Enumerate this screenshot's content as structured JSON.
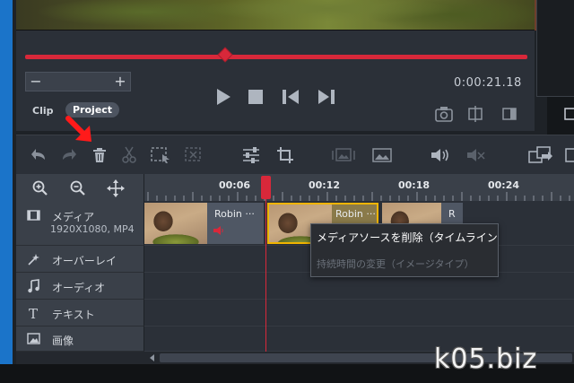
{
  "player": {
    "zoom_minus": "−",
    "zoom_plus": "+",
    "timecode": "0:00:21.18",
    "tabs": [
      {
        "label": "Clip"
      },
      {
        "label": "Project"
      }
    ]
  },
  "toolbar": {
    "icons": [
      "undo-icon",
      "redo-icon",
      "trash-icon",
      "cut-icon",
      "crop-select-icon",
      "split-icon",
      "settings-sliders-icon",
      "crop-icon",
      "image-prev-icon",
      "image-icon",
      "volume-icon",
      "mute-icon",
      "insert-icon"
    ]
  },
  "ruler": {
    "labels": [
      "00:06",
      "00:12",
      "00:18",
      "00:24"
    ]
  },
  "tracks": [
    {
      "label": "メディア",
      "meta": "1920X1080, MP4"
    },
    {
      "label": "オーバーレイ"
    },
    {
      "label": "オーディオ"
    },
    {
      "label": "テキスト"
    },
    {
      "label": "画像"
    }
  ],
  "clips": [
    {
      "name": "Robin ···"
    },
    {
      "name": "Robin ···"
    },
    {
      "name": "R"
    }
  ],
  "tooltip": {
    "line1": "メディアソースを削除（タイムライン",
    "line2": "持続時間の変更（イメージタイプ）"
  },
  "watermark": "k05.biz",
  "colors": {
    "accent_red": "#d8283a",
    "clip_selected": "#f0b400",
    "annotation_arrow": "#ff1a1a",
    "side_blue": "#1b74c9"
  }
}
